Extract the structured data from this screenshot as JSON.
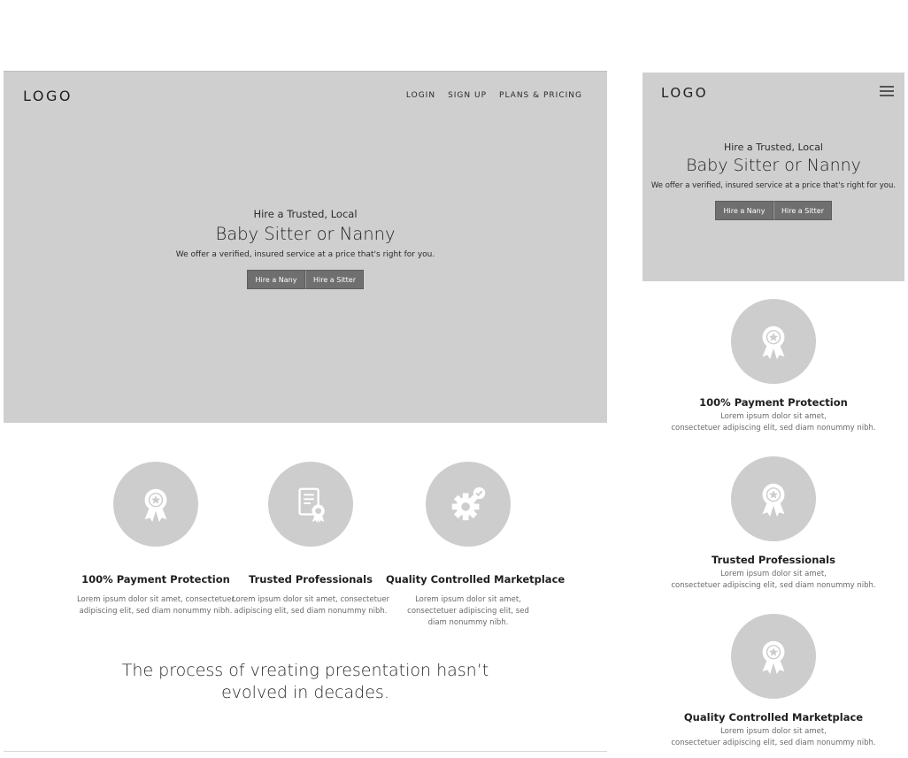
{
  "desktop": {
    "logo": "LOGO",
    "nav": [
      "LOGIN",
      "SIGN UP",
      "PLANS & PRICING"
    ],
    "hero": {
      "eyebrow": "Hire a Trusted, Local",
      "headline": "Baby Sitter or Nanny",
      "subtext": "We offer a verified, insured service at a price that's right for you.",
      "buttons": [
        "Hire a Nany",
        "Hire a Sitter"
      ]
    },
    "features": [
      {
        "title": "100% Payment Protection",
        "desc": "Lorem ipsum dolor sit amet, consectetuer adipiscing elit, sed diam nonummy nibh.",
        "icon": "award-ribbon-icon"
      },
      {
        "title": "Trusted Professionals",
        "desc": "Lorem ipsum dolor sit amet, consectetuer adipiscing elit, sed diam nonummy nibh.",
        "icon": "certificate-icon"
      },
      {
        "title": "Quality Controlled Marketplace",
        "desc": "Lorem ipsum dolor sit amet, consectetuer adipiscing elit, sed diam nonummy nibh.",
        "icon": "gear-check-icon"
      }
    ],
    "tagline_line1": "The process of vreating presentation hasn’t",
    "tagline_line2": "evolved in decades."
  },
  "mobile": {
    "logo": "LOGO",
    "menu_icon": "hamburger-menu-icon",
    "hero": {
      "eyebrow": "Hire a Trusted, Local",
      "headline": "Baby Sitter or Nanny",
      "subtext": "We offer a verified, insured service at a price that's right for you.",
      "buttons": [
        "Hire a Nany",
        "Hire a Sitter"
      ]
    },
    "features": [
      {
        "title": "100% Payment Protection",
        "desc_line1": "Lorem ipsum dolor sit amet,",
        "desc_line2": "consectetuer adipiscing elit, sed diam nonummy nibh.",
        "icon": "award-ribbon-icon"
      },
      {
        "title": "Trusted Professionals",
        "desc_line1": "Lorem ipsum dolor sit amet,",
        "desc_line2": "consectetuer adipiscing elit, sed diam nonummy nibh.",
        "icon": "award-ribbon-icon"
      },
      {
        "title": "Quality Controlled Marketplace",
        "desc_line1": "Lorem ipsum dolor sit amet,",
        "desc_line2": "consectetuer adipiscing elit, sed diam nonummy nibh.",
        "icon": "award-ribbon-icon"
      }
    ]
  },
  "colors": {
    "hero_bg": "#cfcfcf",
    "button_bg": "#6f6f6f",
    "icon_circle": "#cdcdcd",
    "icon_fill": "#ffffff"
  }
}
